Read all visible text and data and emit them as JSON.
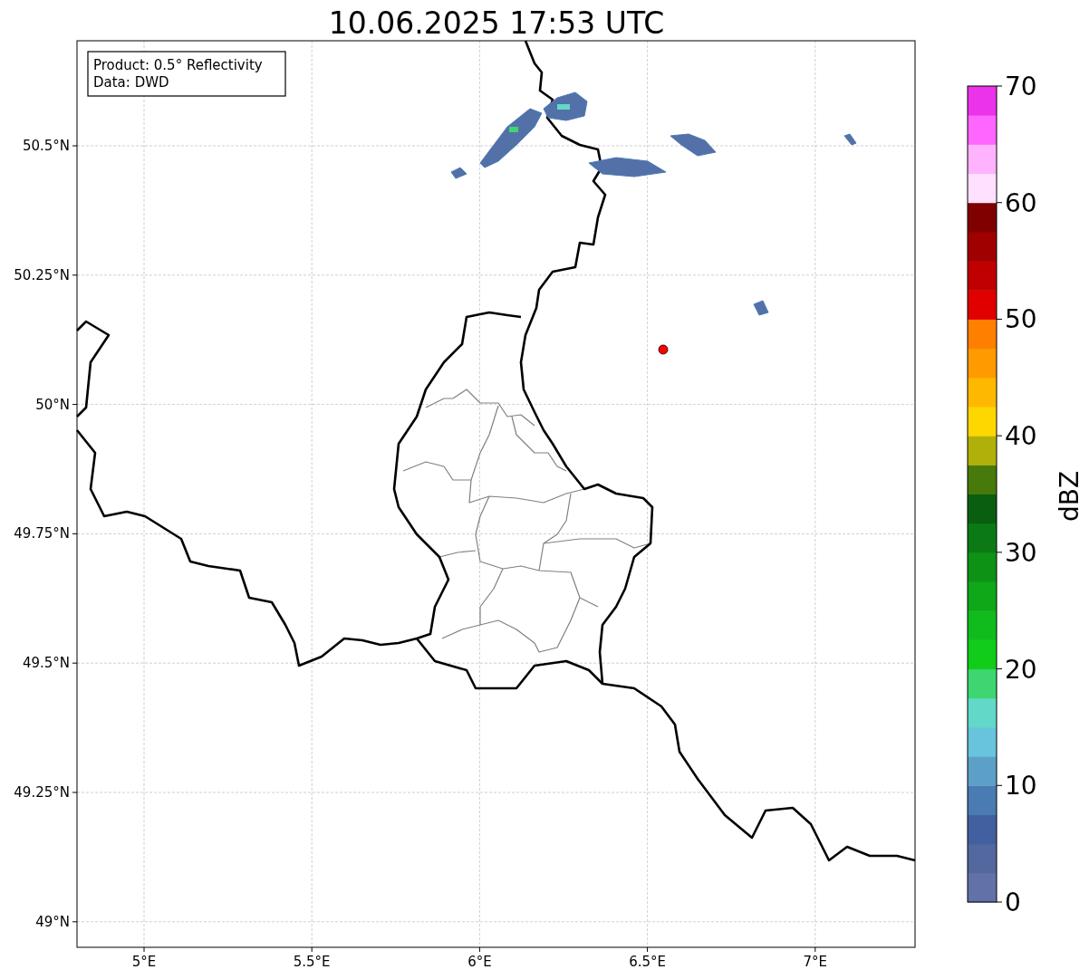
{
  "title": "10.06.2025 17:53 UTC",
  "legend": [
    "Product: 0.5° Reflectivity",
    "Data: DWD"
  ],
  "longitude_ticks": [
    "5°E",
    "5.5°E",
    "6°E",
    "6.5°E",
    "7°E"
  ],
  "latitude_ticks": [
    "50.5°N",
    "50.25°N",
    "50°N",
    "49.75°N",
    "49.5°N",
    "49.25°N",
    "49°N"
  ],
  "colorbar": {
    "label": "dBZ",
    "ticks": [
      "70",
      "60",
      "50",
      "40",
      "30",
      "20",
      "10",
      "0"
    ],
    "bins": [
      {
        "color": "#6272a8"
      },
      {
        "color": "#52689f"
      },
      {
        "color": "#4260a0"
      },
      {
        "color": "#4a7bb2"
      },
      {
        "color": "#5ca0c8"
      },
      {
        "color": "#68c3dc"
      },
      {
        "color": "#62d8c8"
      },
      {
        "color": "#3dd670"
      },
      {
        "color": "#12cc1a"
      },
      {
        "color": "#10bc1c"
      },
      {
        "color": "#0fa818"
      },
      {
        "color": "#0e9216"
      },
      {
        "color": "#0c7a14"
      },
      {
        "color": "#0a5e10"
      },
      {
        "color": "#477a0a"
      },
      {
        "color": "#b0b00a"
      },
      {
        "color": "#ffd700"
      },
      {
        "color": "#ffb800"
      },
      {
        "color": "#ff9a00"
      },
      {
        "color": "#ff7f00"
      },
      {
        "color": "#e00000"
      },
      {
        "color": "#c00000"
      },
      {
        "color": "#a00000"
      },
      {
        "color": "#800000"
      },
      {
        "color": "#ffe0ff"
      },
      {
        "color": "#ffb3ff"
      },
      {
        "color": "#ff66ff"
      },
      {
        "color": "#ea33ea"
      }
    ]
  }
}
